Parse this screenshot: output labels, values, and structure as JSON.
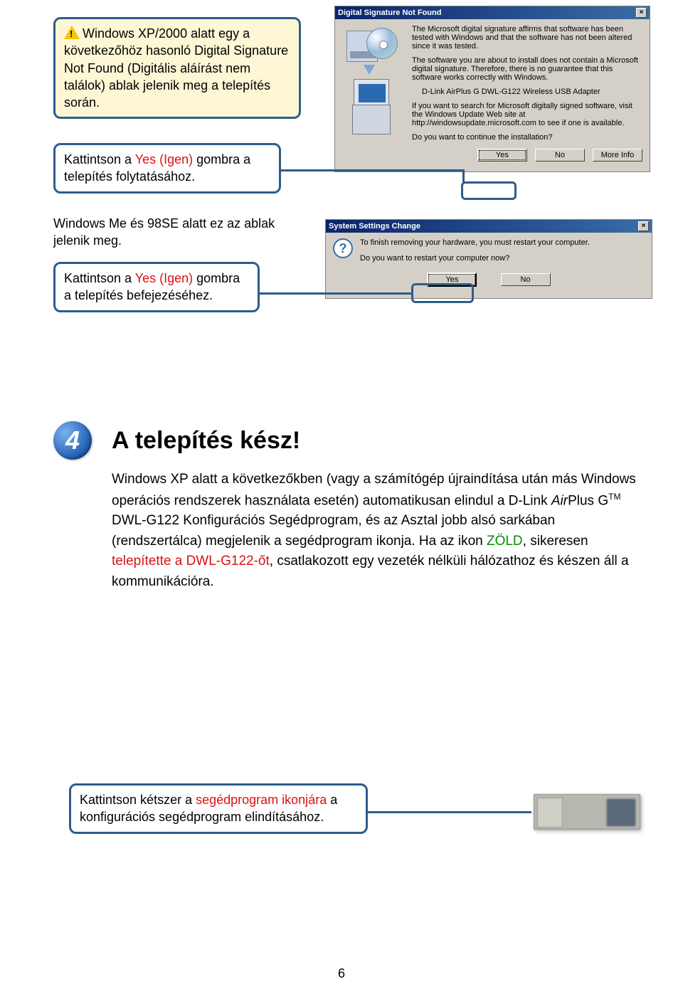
{
  "page_number": "6",
  "callout1": {
    "text": "Windows XP/2000 alatt egy a következőhöz hasonló Digital Signature Not Found (Digitális aláírást nem találok) ablak jelenik meg a telepítés során."
  },
  "callout2": {
    "text_a": "Kattintson a ",
    "yes_word": "Yes (Igen)",
    "text_b": " gombra a telepítés folytatásához."
  },
  "para3": "Windows Me és 98SE alatt ez az ablak jelenik meg.",
  "callout3": {
    "text_a": "Kattintson a ",
    "yes_word": "Yes (Igen)",
    "text_b": " gombra a telepítés befejezéséhez."
  },
  "dialog1": {
    "title": "Digital Signature Not Found",
    "body": {
      "p1": "The Microsoft digital signature affirms that software has been tested with Windows and that the software has not been altered since it was tested.",
      "p2": "The software you are about to install does not contain a Microsoft digital signature. Therefore, there is no guarantee that this software works correctly with Windows.",
      "device": "D-Link AirPlus G DWL-G122 Wireless USB Adapter",
      "p3": "If you want to search for Microsoft digitally signed software, visit the Windows Update Web site at http://windowsupdate.microsoft.com to see if one is available.",
      "q": "Do you want to continue the installation?"
    },
    "buttons": {
      "yes": "Yes",
      "no": "No",
      "more": "More Info"
    }
  },
  "dialog2": {
    "title": "System Settings Change",
    "body": {
      "p1": "To finish removing your hardware, you must restart your computer.",
      "q": "Do you want to restart your computer now?"
    },
    "buttons": {
      "yes": "Yes",
      "no": "No"
    }
  },
  "section4": {
    "number": "4",
    "title": "A telepítés kész!",
    "body_a": "Windows XP alatt a következőkben (vagy a számítógép újraindítása után más Windows operációs rendszerek használata esetén) automatikusan elindul a D-Link ",
    "airplus": "Air",
    "body_a2": "Plus G",
    "tm": "TM",
    "body_a3": " DWL-G122 Konfigurációs Segédprogram, és az Asztal jobb alsó sarkában (rendszertálca) megjelenik a segédprogram ikonja. Ha az ikon ",
    "green": "ZÖLD",
    "body_a4": ", sikeresen ",
    "red1": "telepítette a DWL-G122-őt",
    "body_a5": ", csatlakozott egy vezeték nélküli hálózathoz és készen áll a kommunikációra."
  },
  "callout4": {
    "text_a": "Kattintson kétszer a ",
    "red": "segédprogram ikonjára",
    "text_b": " a konfigurációs segédprogram elindításához."
  }
}
